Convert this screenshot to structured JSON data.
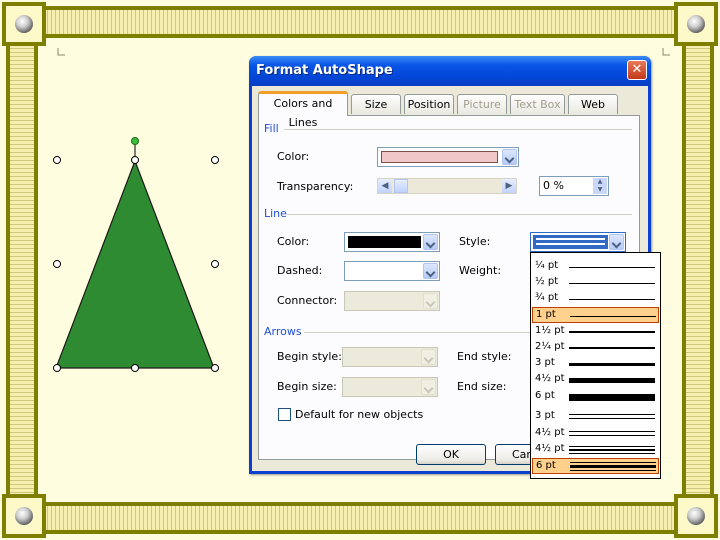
{
  "dialog": {
    "title": "Format AutoShape",
    "tabs": [
      {
        "label": "Colors and Lines",
        "active": true,
        "enabled": true
      },
      {
        "label": "Size",
        "enabled": true
      },
      {
        "label": "Position",
        "enabled": true
      },
      {
        "label": "Picture",
        "enabled": false
      },
      {
        "label": "Text Box",
        "enabled": false
      },
      {
        "label": "Web",
        "enabled": true
      }
    ],
    "fill": {
      "group_label": "Fill",
      "color_label": "Color:",
      "color_value": "#f2c7c7",
      "transparency_label": "Transparency:",
      "transparency_value": "0 %"
    },
    "line": {
      "group_label": "Line",
      "color_label": "Color:",
      "color_value": "#000000",
      "dashed_label": "Dashed:",
      "connector_label": "Connector:",
      "style_label": "Style:",
      "weight_label": "Weight:"
    },
    "arrows": {
      "group_label": "Arrows",
      "begin_style_label": "Begin style:",
      "begin_size_label": "Begin size:",
      "end_style_label": "End style:",
      "end_size_label": "End size:"
    },
    "default_checkbox_label": "Default for new objects",
    "default_checked": false,
    "ok_label": "OK",
    "cancel_label": "Can"
  },
  "style_options": [
    {
      "label": "¼ pt",
      "kind": "single",
      "weight": 0.25
    },
    {
      "label": "½ pt",
      "kind": "single",
      "weight": 0.5
    },
    {
      "label": "¾ pt",
      "kind": "single",
      "weight": 0.75
    },
    {
      "label": "1 pt",
      "kind": "single",
      "weight": 1,
      "selected": true
    },
    {
      "label": "1½ pt",
      "kind": "single",
      "weight": 1.5
    },
    {
      "label": "2¼ pt",
      "kind": "single",
      "weight": 2.25
    },
    {
      "label": "3 pt",
      "kind": "single",
      "weight": 3
    },
    {
      "label": "4½ pt",
      "kind": "single",
      "weight": 4.5
    },
    {
      "label": "6 pt",
      "kind": "single",
      "weight": 6
    },
    {
      "label": "3 pt",
      "kind": "double",
      "weight": 3
    },
    {
      "label": "4½ pt",
      "kind": "double",
      "weight": 4.5
    },
    {
      "label": "4½ pt",
      "kind": "triple",
      "weight": 4.5
    },
    {
      "label": "6 pt",
      "kind": "triple",
      "weight": 6,
      "highlighted": true
    }
  ],
  "shape": {
    "fill_color": "#2e8b32",
    "outline_color": "#1a1a1a"
  }
}
